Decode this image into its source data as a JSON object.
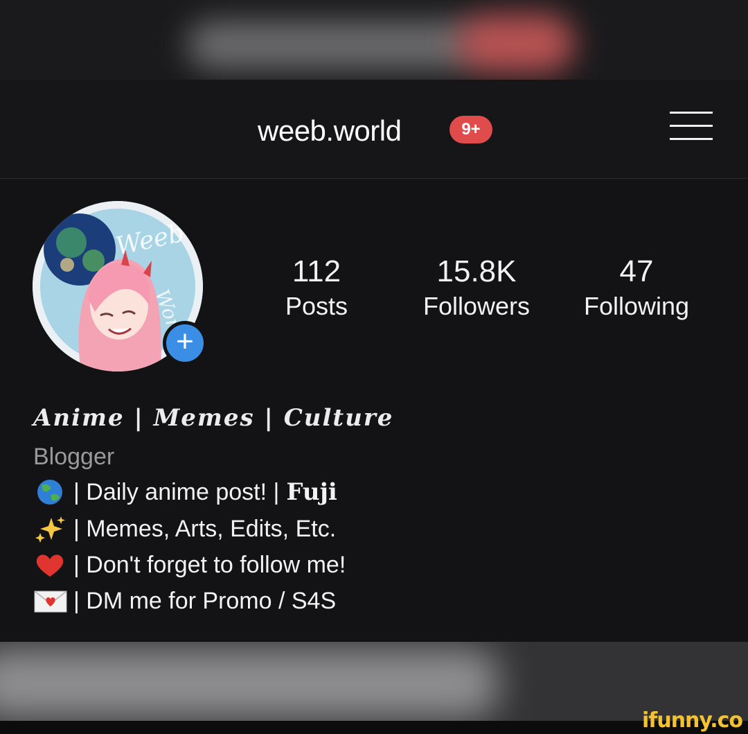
{
  "header": {
    "username": "weeb.world",
    "notification_badge": "9+",
    "menu_icon": "hamburger-menu-icon"
  },
  "profile": {
    "avatar_text": "Weeb World",
    "add_story_symbol": "+",
    "stats": {
      "posts": {
        "value": "112",
        "label": "Posts"
      },
      "followers": {
        "value": "15.8K",
        "label": "Followers"
      },
      "following": {
        "value": "47",
        "label": "Following"
      }
    },
    "bio_title": "Anime | Memes | Culture",
    "category": "Blogger",
    "bio_lines": [
      {
        "emoji": "globe-icon",
        "text": "| Daily anime post! |",
        "bold": "Fuji"
      },
      {
        "emoji": "sparkles-icon",
        "text": "| Memes, Arts, Edits, Etc."
      },
      {
        "emoji": "heart-icon",
        "text": "| Don't forget to follow me!"
      },
      {
        "emoji": "love-letter-icon",
        "text": "| DM me for Promo / S4S"
      }
    ]
  },
  "watermark": "ifunny.co",
  "colors": {
    "background": "#131315",
    "badge": "#e04b4b",
    "add_button": "#3a8ee6",
    "category_text": "#9a9a9c",
    "watermark": "#f3c233"
  }
}
